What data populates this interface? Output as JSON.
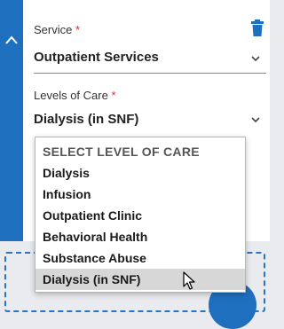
{
  "service": {
    "label": "Service",
    "required_mark": "*",
    "value": "Outpatient Services"
  },
  "levels_of_care": {
    "label": "Levels of Care",
    "required_mark": "*",
    "value": "Dialysis (in SNF)"
  },
  "dropdown": {
    "header": "SELECT LEVEL OF CARE",
    "options": [
      "Dialysis",
      "Infusion",
      "Outpatient Clinic",
      "Behavioral Health",
      "Substance Abuse",
      "Dialysis (in SNF)"
    ],
    "selected_index": 5
  },
  "icons": {
    "collapse": "chevron-up-icon",
    "delete": "trash-icon",
    "dropdown": "chevron-down-icon",
    "pointer": "mouse-pointer-icon"
  },
  "colors": {
    "accent": "#1f6fbf",
    "required": "#d32f2f",
    "selected_option_bg": "#d7d7d7"
  }
}
